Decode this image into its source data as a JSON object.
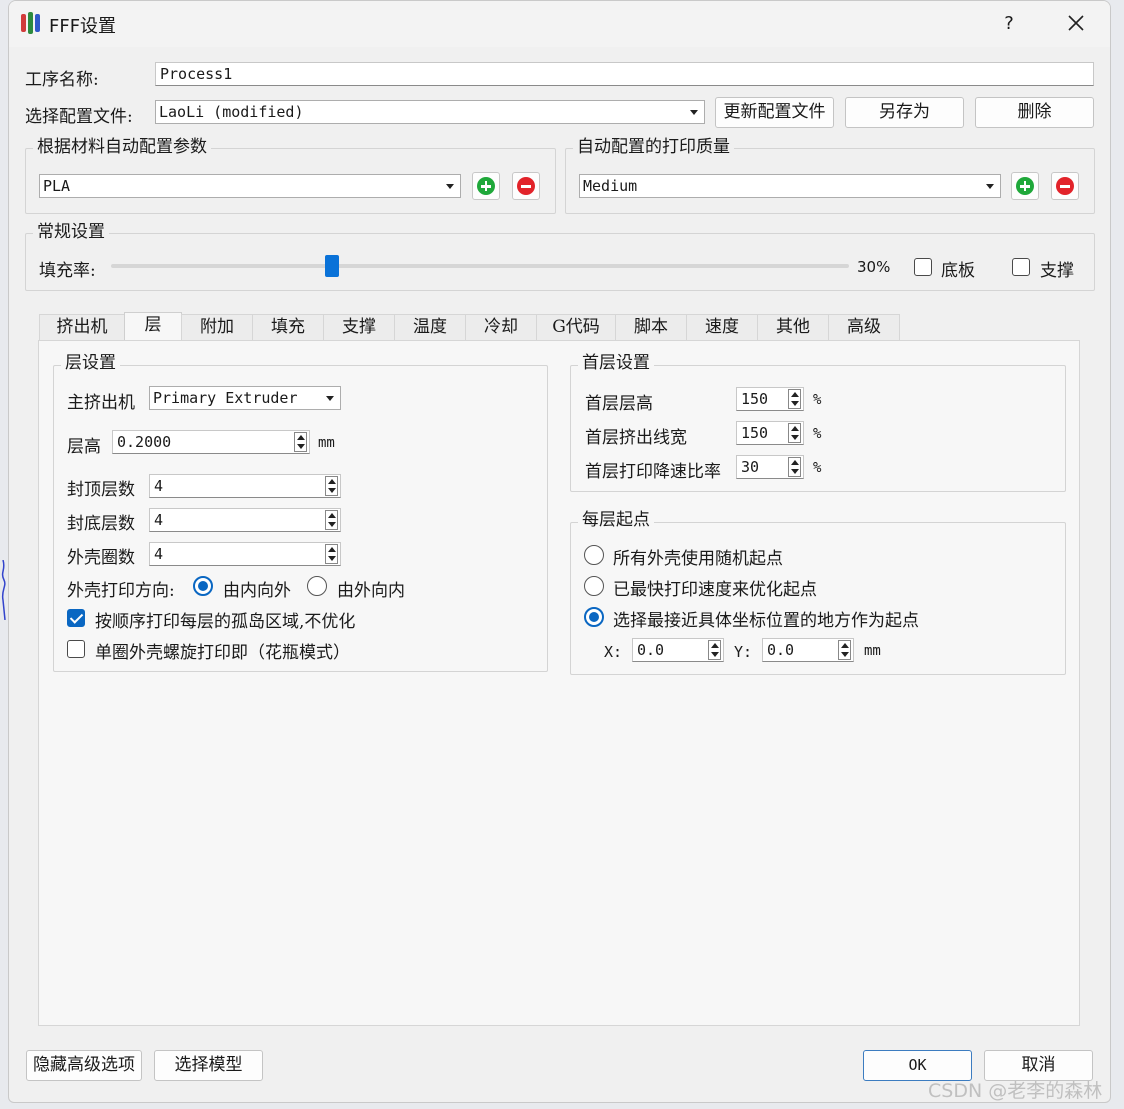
{
  "window": {
    "title": "FFF设置",
    "help": "?",
    "close_icon": "close-icon"
  },
  "process": {
    "label": "工序名称:",
    "value": "Process1"
  },
  "profile": {
    "label": "选择配置文件:",
    "selected": "LaoLi (modified)",
    "update_button": "更新配置文件",
    "save_as_button": "另存为",
    "delete_button": "删除"
  },
  "material_group": {
    "title": "根据材料自动配置参数",
    "selected": "PLA"
  },
  "quality_group": {
    "title": "自动配置的打印质量",
    "selected": "Medium"
  },
  "general_group": {
    "title": "常规设置",
    "infill_label": "填充率:",
    "infill_percent": 30,
    "infill_text": "30%",
    "raft_label": "底板",
    "raft_checked": false,
    "support_label": "支撑",
    "support_checked": false
  },
  "tabs": [
    "挤出机",
    "层",
    "附加",
    "填充",
    "支撑",
    "温度",
    "冷却",
    "G代码",
    "脚本",
    "速度",
    "其他",
    "高级"
  ],
  "active_tab": "层",
  "layer_settings": {
    "title": "层设置",
    "primary_extruder_label": "主挤出机",
    "primary_extruder_value": "Primary Extruder",
    "layer_height_label": "层高",
    "layer_height_value": "0.2000",
    "layer_height_unit": "mm",
    "top_layers_label": "封顶层数",
    "top_layers_value": "4",
    "bottom_layers_label": "封底层数",
    "bottom_layers_value": "4",
    "perimeters_label": "外壳圈数",
    "perimeters_value": "4",
    "direction_label": "外壳打印方向:",
    "direction_inside_out": "由内向外",
    "direction_outside_in": "由外向内",
    "direction_selected": "由内向外",
    "islands_label": "按顺序打印每层的孤岛区域,不优化",
    "islands_checked": true,
    "vase_label": "单圈外壳螺旋打印即（花瓶模式）",
    "vase_checked": false
  },
  "first_layer": {
    "title": "首层设置",
    "height_label": "首层层高",
    "height_value": "150",
    "width_label": "首层挤出线宽",
    "width_value": "150",
    "speed_label": "首层打印降速比率",
    "speed_value": "30",
    "unit": "%"
  },
  "start_points": {
    "title": "每层起点",
    "option_random": "所有外壳使用随机起点",
    "option_fastest": "已最快打印速度来优化起点",
    "option_closest": "选择最接近具体坐标位置的地方作为起点",
    "selected": "选择最接近具体坐标位置的地方作为起点",
    "x_label": "X:",
    "x_value": "0.0",
    "y_label": "Y:",
    "y_value": "0.0",
    "unit": "mm"
  },
  "footer": {
    "hide_advanced": "隐藏高级选项",
    "select_model": "选择模型",
    "ok": "OK",
    "cancel": "取消"
  },
  "watermark": "CSDN @老李的森林",
  "colors": {
    "accent": "#0a67c2",
    "slider": "#0a72d8",
    "add": "#1fa83a",
    "remove": "#e2232a"
  }
}
